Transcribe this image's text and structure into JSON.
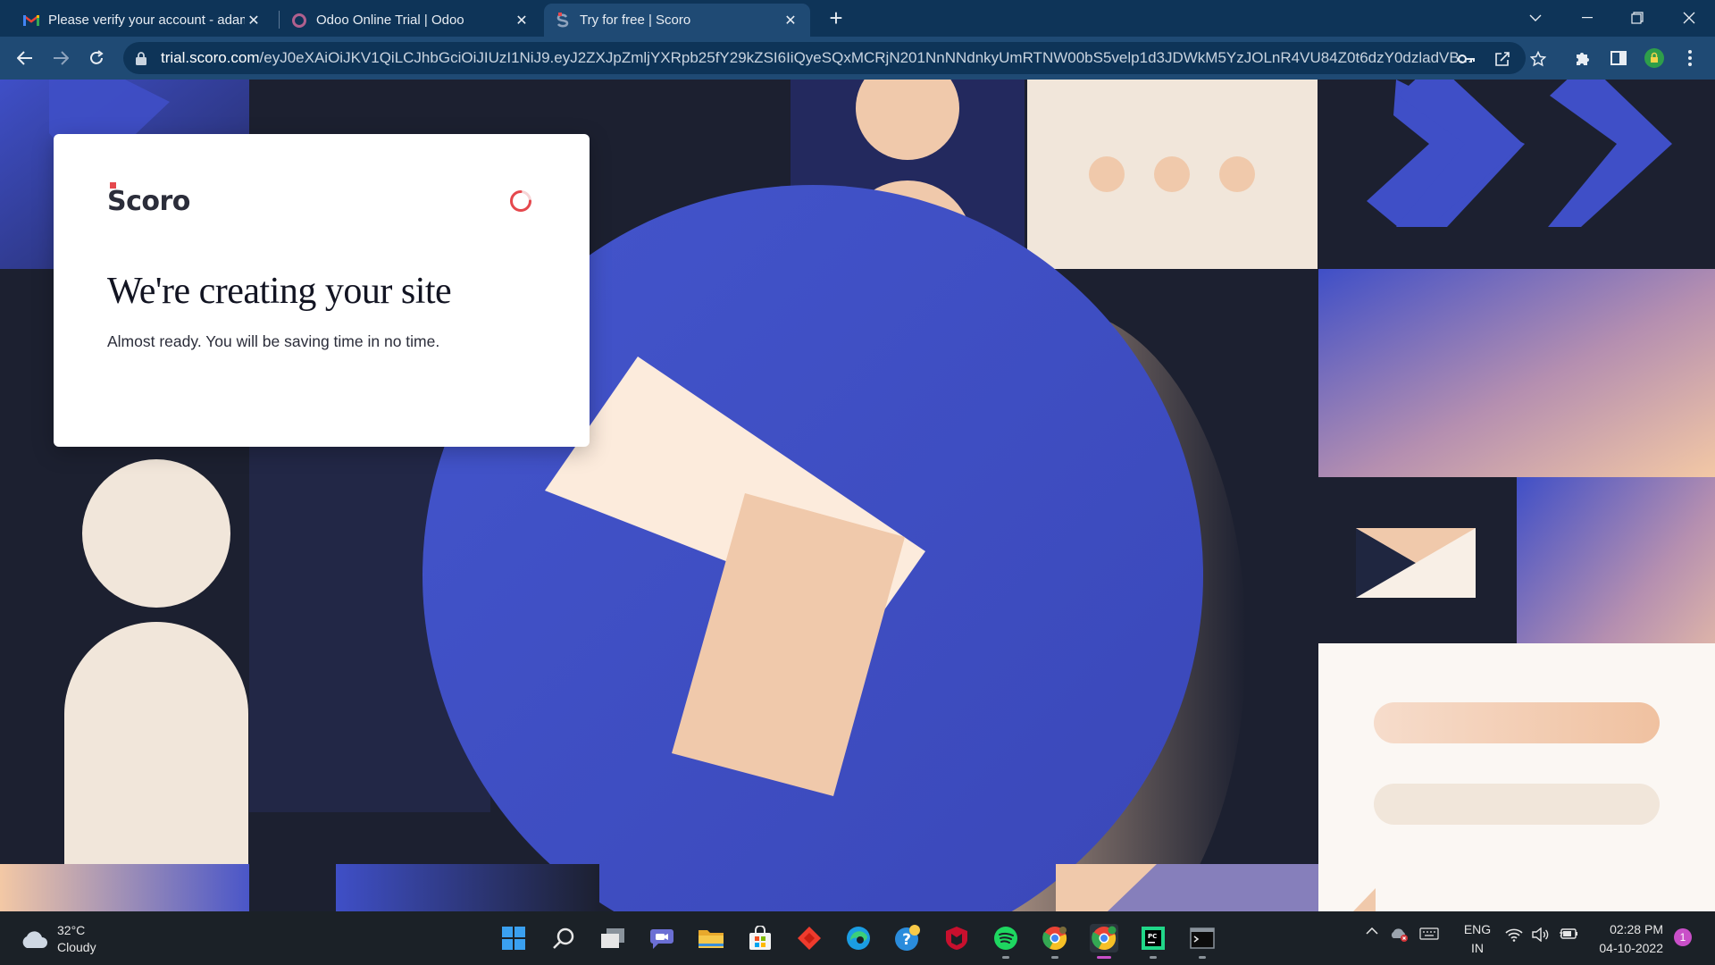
{
  "browser": {
    "tabs": [
      {
        "title": "Please verify your account - adam",
        "favicon": "gmail-icon",
        "active": false
      },
      {
        "title": "Odoo Online Trial | Odoo",
        "favicon": "odoo-icon",
        "active": false
      },
      {
        "title": "Try for free | Scoro",
        "favicon": "scoro-icon",
        "active": true
      }
    ],
    "url_host": "trial.scoro.com",
    "url_path": "/eyJ0eXAiOiJKV1QiLCJhbGciOiJIUzI1NiJ9.eyJ2ZXJpZmljYXRpb25fY29kZSI6IiQyeSQxMCRjN201NnNNdnkyUmRTNW00bS5velp1d3JDWkM5YzJOLnR4VU84Z0t6dzY0dzladVB..."
  },
  "card": {
    "logo_text": "Scoro",
    "heading": "We're creating your site",
    "subtext": "Almost ready. You will be saving time in no time."
  },
  "taskbar": {
    "weather_temp": "32°C",
    "weather_desc": "Cloudy",
    "lang_top": "ENG",
    "lang_bottom": "IN",
    "time": "02:28 PM",
    "date": "04-10-2022",
    "notification_count": "1"
  },
  "colors": {
    "chrome_dark": "#0e3458",
    "chrome_light": "#1f4a74",
    "page_bg": "#1c2030",
    "accent_blue": "#3f4fc7",
    "peach": "#f0c9ab",
    "cream": "#f1e6da",
    "scoro_red": "#e5484d"
  }
}
